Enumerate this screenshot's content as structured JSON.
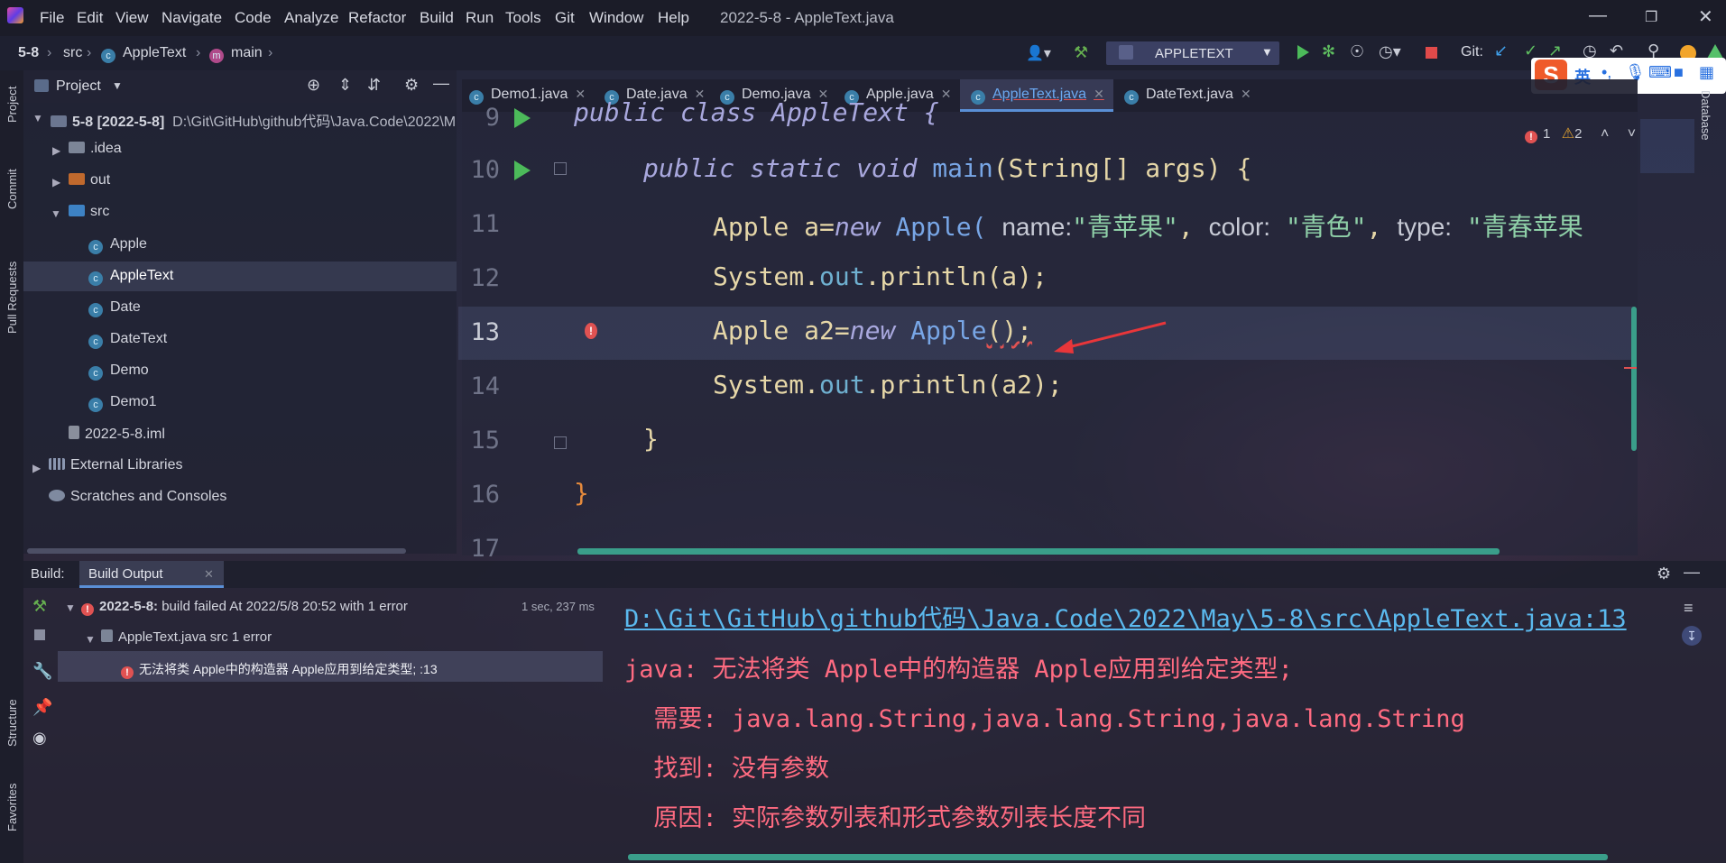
{
  "window": {
    "title": "2022-5-8 - AppleText.java",
    "menu": [
      "File",
      "Edit",
      "View",
      "Navigate",
      "Code",
      "Analyze",
      "Refactor",
      "Build",
      "Run",
      "Tools",
      "Git",
      "Window",
      "Help"
    ]
  },
  "breadcrumb": [
    "5-8",
    "src",
    "AppleText",
    "main"
  ],
  "toolbar": {
    "run_config": "APPLETEXT",
    "git_label": "Git:"
  },
  "ime": {
    "lang": "英"
  },
  "left_stripe": [
    "Project",
    "Commit",
    "Pull Requests",
    "Structure",
    "Favorites"
  ],
  "right_stripe": [
    "Database"
  ],
  "project": {
    "header": "Project",
    "root_name": "5-8 [2022-5-8]",
    "root_path": "D:\\Git\\GitHub\\github代码\\Java.Code\\2022\\M",
    "items": [
      {
        "label": ".idea"
      },
      {
        "label": "out"
      },
      {
        "label": "src"
      },
      {
        "label": "Apple"
      },
      {
        "label": "AppleText"
      },
      {
        "label": "Date"
      },
      {
        "label": "DateText"
      },
      {
        "label": "Demo"
      },
      {
        "label": "Demo1"
      },
      {
        "label": "2022-5-8.iml"
      },
      {
        "label": "External Libraries"
      },
      {
        "label": "Scratches and Consoles"
      }
    ]
  },
  "tabs": [
    {
      "label": "Demo1.java"
    },
    {
      "label": "Date.java"
    },
    {
      "label": "Demo.java"
    },
    {
      "label": "Apple.java"
    },
    {
      "label": "AppleText.java",
      "active": true
    },
    {
      "label": "DateText.java"
    }
  ],
  "inspections": {
    "errors": "1",
    "warnings": "2"
  },
  "editor": {
    "line_numbers": [
      "9",
      "10",
      "11",
      "12",
      "13",
      "14",
      "15",
      "16",
      "17"
    ],
    "line9": "public class AppleText {",
    "line10": {
      "mods": "public static void",
      "name": "main",
      "args": "(String[] args) {"
    },
    "line11": {
      "type": "Apple",
      "var": "a=",
      "kw": "new",
      "cls": "Apple(",
      "hint1": "name:",
      "s1": "\"青苹果\"",
      "hint2": "color:",
      "s2": "\"青色\"",
      "hint3": "type:",
      "s3": "\"青春苹果"
    },
    "line12": {
      "obj": "System.",
      "fld": "out",
      "rest": ".println(a);"
    },
    "line13": {
      "type": "Apple",
      "var": "a2=",
      "kw": "new",
      "cls": "Apple",
      "rest": "();"
    },
    "line14": {
      "obj": "System.",
      "fld": "out",
      "rest": ".println(a2);"
    },
    "line15": "}",
    "line16": "}"
  },
  "build": {
    "tab_prefix": "Build:",
    "tab_label": "Build Output",
    "root": "2022-5-8:",
    "root_status": "build failed At 2022/5/8 20:52 with 1 error",
    "duration": "1 sec, 237 ms",
    "file": "AppleText.java src 1 error",
    "error": "无法将类 Apple中的构造器 Apple应用到给定类型; :13",
    "output_path": "D:\\Git\\GitHub\\github代码\\Java.Code\\2022\\May\\5-8\\src\\AppleText.java:13",
    "output_line1": "java: 无法将类 Apple中的构造器 Apple应用到给定类型;",
    "output_line2": "  需要: java.lang.String,java.lang.String,java.lang.String",
    "output_line3": "  找到: 没有参数",
    "output_line4": "  原因: 实际参数列表和形式参数列表长度不同"
  }
}
